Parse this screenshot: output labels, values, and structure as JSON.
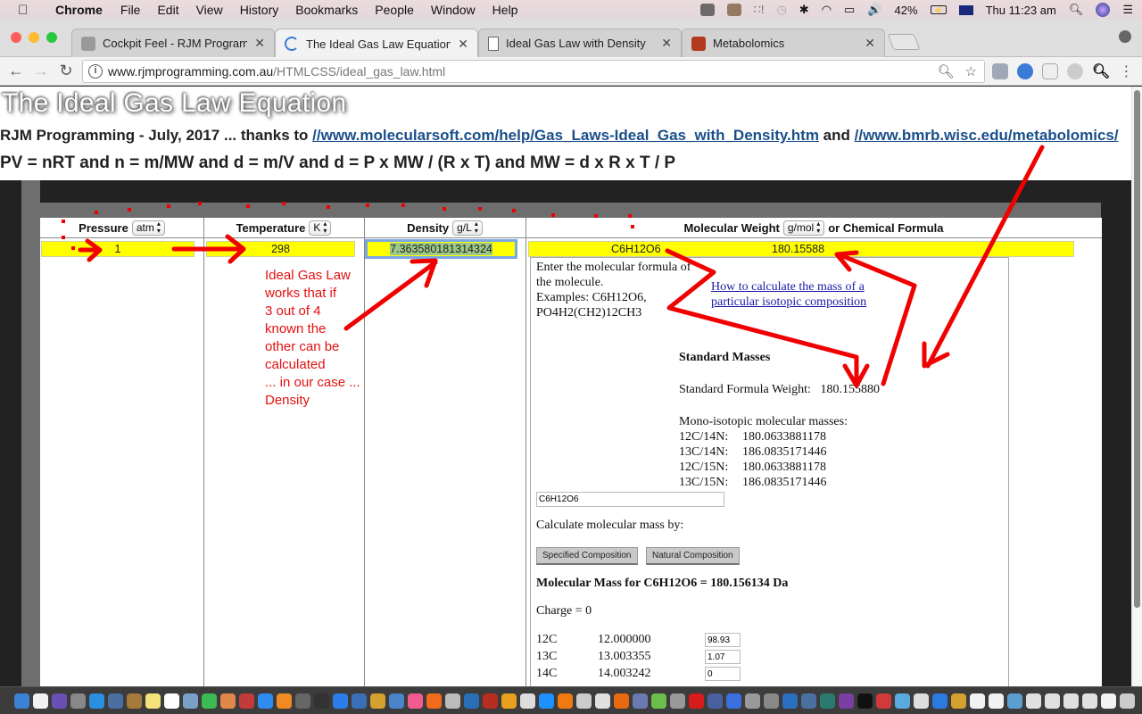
{
  "menubar": {
    "app": "Chrome",
    "items": [
      "File",
      "Edit",
      "View",
      "History",
      "Bookmarks",
      "People",
      "Window",
      "Help"
    ],
    "battery": "42%",
    "clock": "Thu 11:23 am"
  },
  "browser": {
    "tabs": [
      {
        "title": "Cockpit Feel - RJM Programmi",
        "active": false,
        "favicon_color": "#8a8a8a"
      },
      {
        "title": "The Ideal Gas Law Equation - R",
        "active": true,
        "favicon_color": "#3a7bd5"
      },
      {
        "title": "Ideal Gas Law with Density",
        "active": false,
        "favicon_color": "#ffffff"
      },
      {
        "title": "Metabolomics",
        "active": false,
        "favicon_color": "#b33a1e"
      }
    ],
    "url_host": "www.rjmprogramming.com.au",
    "url_path": "/HTMLCSS/ideal_gas_law.html"
  },
  "page": {
    "title": "The Ideal Gas Law Equation",
    "credit_prefix": "RJM Programming - July, 2017 ... thanks to ",
    "credit_link1": "//www.molecularsoft.com/help/Gas_Laws-Ideal_Gas_with_Density.htm",
    "credit_and": " and ",
    "credit_link2": "//www.bmrb.wisc.edu/metabolomics/",
    "formula": "PV = nRT and n = m/MW and d = m/V and d = P x MW / (R x T) and MW = d x R x T / P",
    "columns": {
      "pressure": {
        "label": "Pressure",
        "unit": "atm",
        "value": "1"
      },
      "temperature": {
        "label": "Temperature",
        "unit": "K",
        "value": "298"
      },
      "density": {
        "label": "Density",
        "unit": "g/L",
        "value": "7.363580181314324"
      },
      "molweight": {
        "label": "Molecular Weight",
        "unit": "g/mol",
        "suffix": "or Chemical Formula",
        "formula_value": "C6H12O6",
        "value": "180.15588"
      }
    },
    "annotation_note": [
      "Ideal Gas Law",
      "works that if",
      "3 out of 4",
      "known the",
      "other can be",
      "calculated",
      "... in our case ...",
      "Density"
    ],
    "annotation_color": "#e41010"
  },
  "calculator": {
    "intro": [
      "Enter the molecular formula of",
      "the molecule.",
      "Examples: C6H12O6,",
      "PO4H2(CH2)12CH3"
    ],
    "howto_link": [
      "How to calculate the mass of a",
      "particular isotopic composition"
    ],
    "standard_heading": "Standard Masses",
    "standard_label": "Standard Formula Weight:",
    "standard_value": "180.155880",
    "mono_heading": "Mono-isotopic molecular masses:",
    "mono": [
      {
        "label": "12C/14N:",
        "value": "180.0633881178"
      },
      {
        "label": "13C/14N:",
        "value": "186.0835171446"
      },
      {
        "label": "12C/15N:",
        "value": "180.0633881178"
      },
      {
        "label": "13C/15N:",
        "value": "186.0835171446"
      }
    ],
    "formula_input": "C6H12O6",
    "calc_by": "Calculate molecular mass by:",
    "btn_specified": "Specified Composition",
    "btn_natural": "Natural Composition",
    "result": "Molecular Mass for C6H12O6 = 180.156134 Da",
    "charge": "Charge = 0",
    "isotopes": [
      {
        "name": "12C",
        "mass": "12.000000",
        "abundance": "98.93"
      },
      {
        "name": "13C",
        "mass": "13.003355",
        "abundance": "1.07"
      },
      {
        "name": "14C",
        "mass": "14.003242",
        "abundance": "0"
      }
    ]
  },
  "dock": {
    "colors": [
      "#3b82d6",
      "#f2f2f2",
      "#6a4fb5",
      "#888888",
      "#2a8fe0",
      "#4a6fa0",
      "#a57a3a",
      "#f4e27a",
      "#ffffff",
      "#7aa0c8",
      "#3cba54",
      "#e0884a",
      "#c23b3b",
      "#2d8cf0",
      "#f08a24",
      "#666666",
      "#333333",
      "#2b7de9",
      "#3b6fb5",
      "#d4a030",
      "#4a84c8",
      "#f25b8f",
      "#f26b1d",
      "#bbbbbb",
      "#2a6fb5",
      "#b72d20",
      "#e8a020",
      "#dddddd",
      "#1e90ff",
      "#f07a10",
      "#cccccc",
      "#e0e0e0",
      "#e86a10",
      "#6a7ab0",
      "#6abf4b",
      "#999999",
      "#d81b1b",
      "#4a5fa0",
      "#3a6fe0",
      "#999999",
      "#888888",
      "#2a6fc0",
      "#4a70a0",
      "#2a7a70",
      "#7a3fa0",
      "#111111",
      "#d03a3a",
      "#5aaae0",
      "#dddddd",
      "#2a7ae0",
      "#d4a030",
      "#f2f2f2",
      "#f2f2f2",
      "#5a9fd0",
      "#e0e0e0",
      "#e0e0e0",
      "#e0e0e0",
      "#e0e0e0",
      "#f2f2f2",
      "#cccccc"
    ]
  }
}
